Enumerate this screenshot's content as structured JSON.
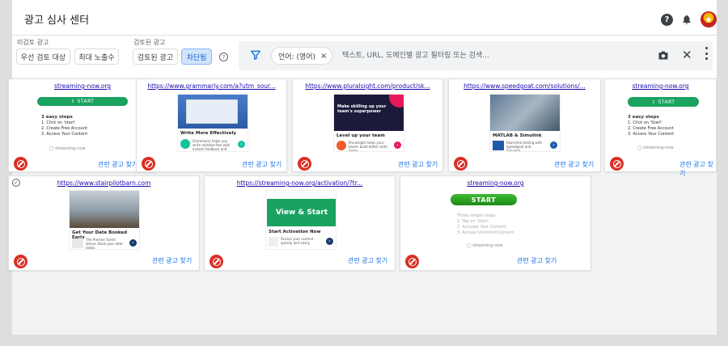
{
  "header": {
    "title": "광고 심사 센터",
    "help_icon": "help-circle-icon",
    "notification_icon": "bell-icon",
    "avatar_icon": "avatar-icon"
  },
  "filters": {
    "unreviewed_label": "미검토 광고",
    "reviewed_label": "검토된 광고",
    "chips": {
      "priority": "우선 검토 대상",
      "max_exposure": "최대 노출수",
      "reviewed_ads": "검토된 광고",
      "blocked": "차단됨"
    },
    "help_q": "?"
  },
  "search": {
    "language_chip": "언어: (영어)",
    "language_close": "×",
    "placeholder": "텍스트, URL, 도메인별 광고 필터링 또는 검색...",
    "clear": "✕"
  },
  "cards": [
    {
      "url": "streaming-now.org",
      "related": "관련 광고 찾기",
      "start": "⇩ START",
      "steps_title": "3 easy steps",
      "steps": [
        "1. Click on 'start'",
        "2. Create Free Account",
        "3. Access Your Content"
      ],
      "logo": "◯ streaming-now"
    },
    {
      "url": "https://www.grammarly.com/a?utm_sour...",
      "related": "관련 광고 찾기",
      "title": "Write More Effectively",
      "text": "Grammarly helps you write mistake-free with instant feedback and suggestions."
    },
    {
      "url": "https://www.pluralsight.com/product/sk...",
      "related": "관련 광고 찾기",
      "headline": "Make skilling up your team's superpower",
      "title": "Level up your team",
      "text": "Pluralsight helps your teams build better skills faster."
    },
    {
      "url": "https://www.speedgoat.com/solutions/...",
      "related": "관련 광고 찾기",
      "title": "MATLAB & Simulink",
      "text": "Real-time testing with Speedgoat and Simulink."
    },
    {
      "url": "streaming-now.org",
      "related": "관련 광고 찾기",
      "start": "⇩ START",
      "steps_title": "3 easy steps",
      "steps": [
        "1. Click on 'Start'",
        "2. Create Free Account",
        "3. Access Your Content"
      ],
      "logo": "◯ streaming-now"
    },
    {
      "url": "https://www.stairpilotbarn.com",
      "related": "관련 광고 찾기",
      "title": "Get Your Date Booked Early",
      "text": "The Premier Event Venue. Book your date today."
    },
    {
      "url": "https://streaming-now.org/activation/?tr...",
      "related": "관련 광고 찾기",
      "cta": "View & Start",
      "title": "Start Activation Now",
      "text": "Access your content quickly and easily."
    },
    {
      "url": "streaming-now.org",
      "related": "관련 광고 찾기",
      "start": "START",
      "steps_title": "Three simple steps",
      "steps": [
        "1. Tap on 'Start'",
        "2. Activate Your Content",
        "3. Access Unlimited Content"
      ],
      "logo": "◯ streaming-now"
    }
  ],
  "colors": {
    "block": "#d93025",
    "link": "#1a73e8",
    "start_green": "#1aa260",
    "selected_chip": "#d2e3fc"
  }
}
